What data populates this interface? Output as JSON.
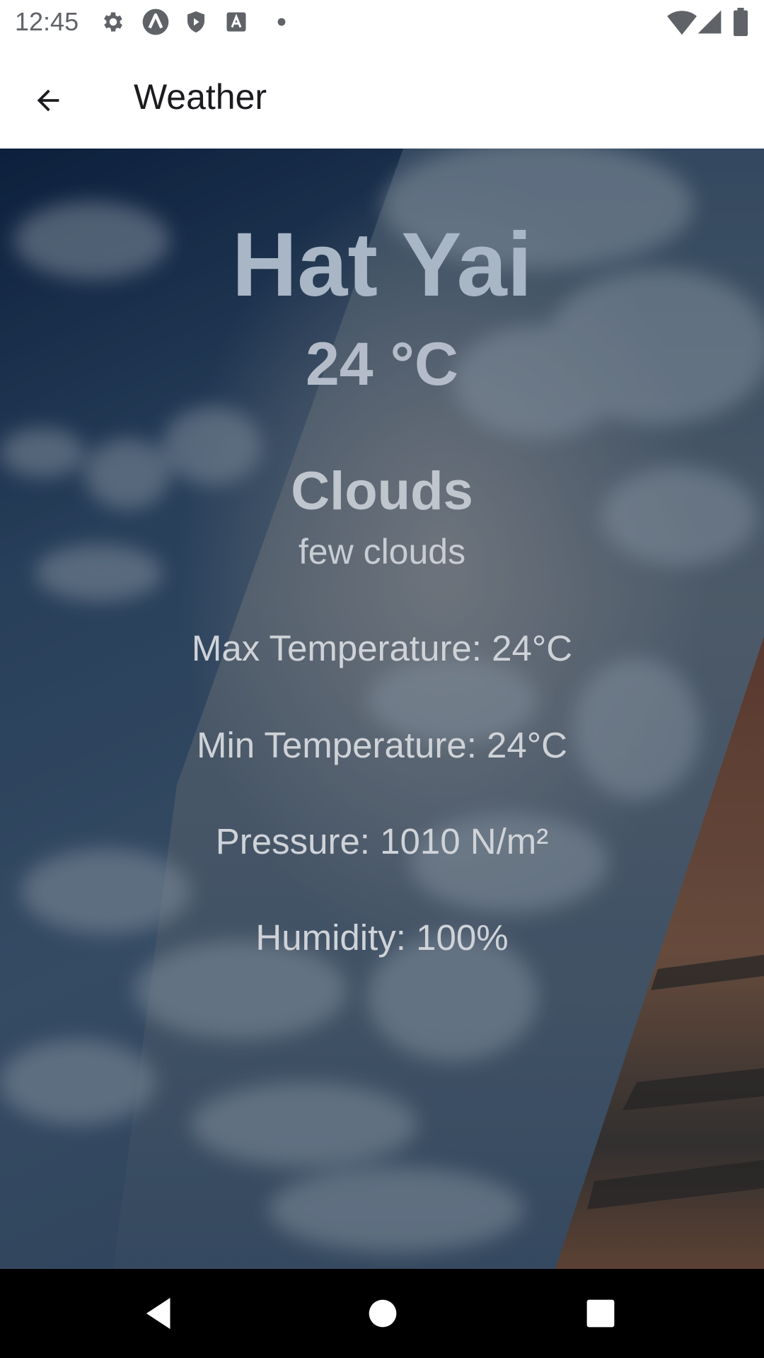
{
  "status_bar": {
    "time": "12:45",
    "icons": [
      "settings-icon",
      "app-a-icon",
      "play-protect-icon",
      "font-a-icon",
      "dot-icon",
      "wifi-icon",
      "cellular-signal-icon",
      "battery-icon"
    ]
  },
  "app_bar": {
    "back_icon": "arrow-back-icon",
    "title": "Weather"
  },
  "weather": {
    "city": "Hat Yai",
    "temperature": "24 °C",
    "condition": "Clouds",
    "description": "few clouds",
    "max_temperature": "Max Temperature: 24°C",
    "min_temperature": "Min Temperature: 24°C",
    "pressure": "Pressure: 1010 N/m²",
    "humidity": "Humidity: 100%"
  },
  "nav_bar": {
    "back": "nav-back-icon",
    "home": "nav-home-icon",
    "recents": "nav-recents-icon"
  },
  "colors": {
    "sky_dark": "#0f2440",
    "sky_mid": "#3a5470",
    "text": "#cfd3d8",
    "sunset": "#8a5a3c"
  }
}
